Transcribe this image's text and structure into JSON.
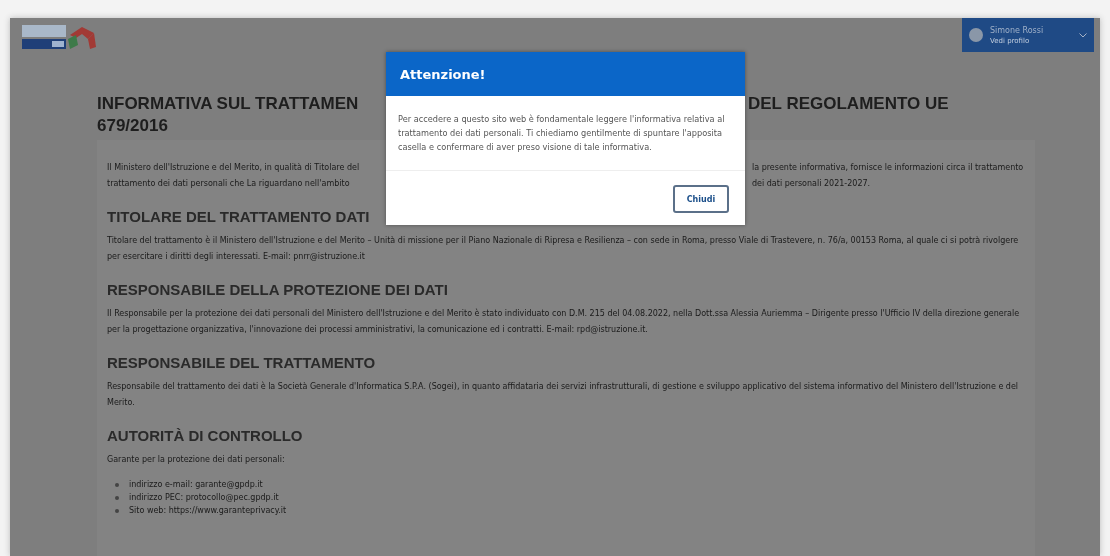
{
  "header": {
    "user": {
      "name": "Simone Rossi",
      "subtitle": "Vedi profilo"
    }
  },
  "page": {
    "title_left": "INFORMATIVA SUL TRATTAMEN",
    "title_right": "DEL REGOLAMENTO UE",
    "title_line2": "679/2016",
    "intro_left": "Il Ministero dell'Istruzione e del Merito, in qualità di Titolare del trattamento dei dati personali che La riguardano nell'ambito",
    "intro_right": "la presente informativa, fornisce le informazioni circa il trattamento dei dati personali 2021-2027.",
    "sections": [
      {
        "heading": "TITOLARE DEL TRATTAMENTO DATI",
        "text": "Titolare del trattamento è il Ministero dell'Istruzione e del Merito – Unità di missione per il Piano Nazionale di Ripresa e Resilienza – con sede in Roma, presso Viale di Trastevere, n. 76/a, 00153 Roma, al quale ci si potrà rivolgere per esercitare i diritti degli interessati. E-mail: pnrr@istruzione.it"
      },
      {
        "heading": "RESPONSABILE DELLA PROTEZIONE DEI DATI",
        "text": "Il Responsabile per la protezione dei dati personali del Ministero dell'Istruzione e del Merito è stato individuato con D.M. 215 del 04.08.2022, nella Dott.ssa Alessia Auriemma – Dirigente presso l'Ufficio IV della direzione generale per la progettazione organizzativa, l'innovazione dei processi amministrativi, la comunicazione ed i contratti. E-mail: rpd@istruzione.it."
      },
      {
        "heading": "RESPONSABILE DEL TRATTAMENTO",
        "text": "Responsabile del trattamento dei dati è la Società Generale d'Informatica S.P.A. (Sogei), in quanto affidataria dei servizi infrastrutturali, di gestione e sviluppo applicativo del sistema informativo del Ministero dell'Istruzione e del Merito."
      },
      {
        "heading": "AUTORITÀ DI CONTROLLO",
        "text": "Garante per la protezione dei dati personali:",
        "items": [
          "indirizzo e-mail: garante@gpdp.it",
          "indirizzo PEC: protocollo@pec.gpdp.it",
          "Sito web: https://www.garanteprivacy.it"
        ]
      }
    ]
  },
  "modal": {
    "title": "Attenzione!",
    "body": "Per accedere a questo sito web è fondamentale leggere l'informativa relativa al trattamento dei dati personali. Ti chiediamo gentilmente di spuntare l'apposita casella e confermare di aver preso visione di tale informativa.",
    "button": "Chiudi"
  }
}
